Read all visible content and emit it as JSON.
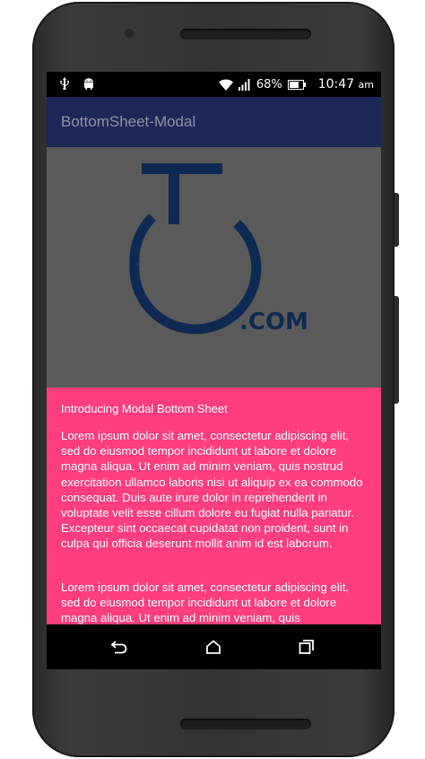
{
  "status": {
    "battery": "68%",
    "time": "10:47",
    "ampm": "am"
  },
  "appbar": {
    "title": "BottomSheet-Modal"
  },
  "logo": {
    "suffix": ".COM",
    "color": "#0f2a52"
  },
  "sheet": {
    "title": "Introducing Modal Bottom Sheet",
    "paragraph1": "Lorem ipsum dolor sit amet, consectetur adipiscing elit, sed do eiusmod tempor incididunt ut labore et dolore magna aliqua. Ut enim ad minim veniam, quis nostrud exercitation ullamco laboris nisi ut aliquip ex ea commodo consequat. Duis aute irure dolor in reprehenderit in voluptate velit esse cillum dolore eu fugiat nulla pariatur. Excepteur sint occaecat cupidatat non proident, sunt in culpa qui officia deserunt mollit anim id est laborum.",
    "paragraph2": "Lorem ipsum dolor sit amet, consectetur adipiscing elit, sed do eiusmod tempor incididunt ut labore et dolore magna aliqua. Ut enim ad minim veniam, quis",
    "color": "#ff3d7f"
  },
  "icons": {
    "usb": "usb-icon",
    "android": "android-icon",
    "wifi": "wifi-icon",
    "signal": "signal-icon",
    "battery": "battery-icon",
    "back": "back-icon",
    "home": "home-icon",
    "recents": "recents-icon"
  }
}
